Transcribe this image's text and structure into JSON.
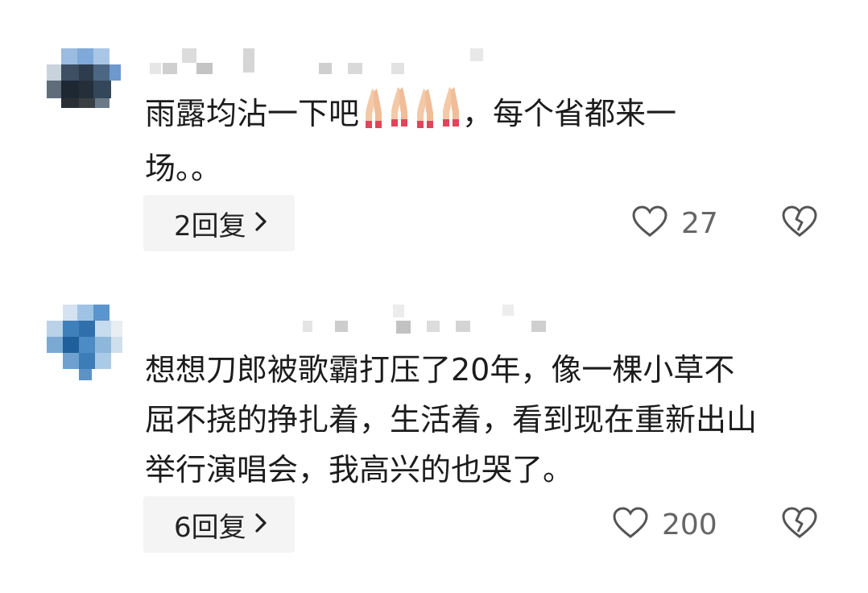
{
  "comments": [
    {
      "text_lines": [
        "雨露均沾一下吧",
        "，每个省都来一",
        "场。。"
      ],
      "reply_label": "2回复",
      "like_count": "27",
      "icons": [
        "avatar-icon",
        "pray-icon",
        "heart-outline-icon",
        "broken-heart-icon",
        "chevron-right-icon"
      ]
    },
    {
      "text_lines": [
        "想想刀郎被歌霸打压了20年，像一棵小草不",
        "屈不挠的挣扎着，生活着，看到现在重新出山",
        "举行演唱会，我高兴的也哭了。"
      ],
      "reply_label": "6回复",
      "like_count": "200",
      "icons": [
        "avatar-icon",
        "heart-outline-icon",
        "broken-heart-icon",
        "chevron-right-icon"
      ]
    }
  ],
  "colors": {
    "text": "#1c1c1c",
    "count": "#666666",
    "reply_bg": "#f4f4f4",
    "icon_stroke": "#555555"
  }
}
